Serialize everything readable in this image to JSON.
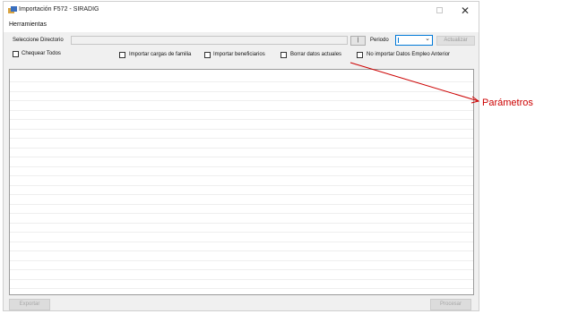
{
  "window": {
    "title": "Importación F572 - SIRADIG",
    "maximize_icon": "maximize-icon",
    "close_icon": "close-icon",
    "close_glyph": "✕"
  },
  "menu": {
    "herramientas": "Herramientas"
  },
  "toolbar": {
    "dir_label": "Seleccione Directorio",
    "dir_value": "",
    "browse_label": "|",
    "periodo_label": "Periodo",
    "periodo_value": "",
    "actualizar_label": "Actualizar"
  },
  "options": {
    "chequear_todos": "Chequear Todos",
    "cargas_familia": "Importar cargas de familia",
    "beneficiarios": "Importar beneficiarios",
    "borrar_datos": "Borrar datos actuales",
    "no_importar": "No importar Datos Empleo Anterior"
  },
  "footer": {
    "exportar": "Exportar",
    "procesar": "Procesar"
  },
  "annotation": {
    "label": "Parámetros",
    "color": "#cc0000"
  }
}
